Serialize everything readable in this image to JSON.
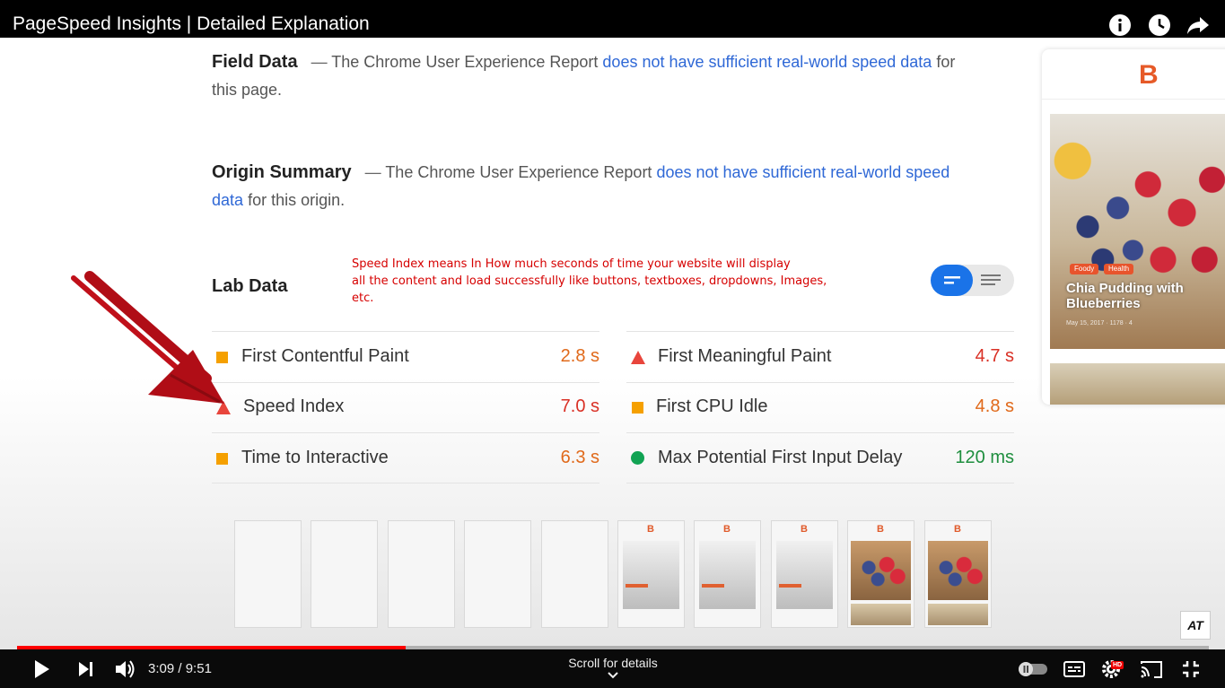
{
  "video": {
    "title": "PageSpeed Insights | Detailed Explanation",
    "time_current": "3:09",
    "time_separator": " / ",
    "time_total": "9:51",
    "progress": 0.326,
    "scroll_hint": "Scroll for details",
    "accent_color": "#ff0000"
  },
  "field_data": {
    "heading": "Field Data",
    "dash": "—",
    "text_before": "The Chrome User Experience Report",
    "link": "does not have sufficient real-world speed data",
    "text_after_line1": "for",
    "text_line2": "this page."
  },
  "origin_summary": {
    "heading": "Origin Summary",
    "dash": "—",
    "text_before": "The Chrome User Experience Report",
    "link_line1": "does not have sufficient real-world speed",
    "link_line2": "data",
    "text_after": "for this origin."
  },
  "lab_data": {
    "heading": "Lab Data",
    "annotation_lines": [
      "Speed Index means In How much seconds of time your website will display",
      "all the content and load successfully like buttons, textboxes, dropdowns, Images,",
      "etc."
    ],
    "metrics": [
      {
        "label": "First Contentful Paint",
        "value": "2.8 s",
        "status": "average"
      },
      {
        "label": "First Meaningful Paint",
        "value": "4.7 s",
        "status": "slow"
      },
      {
        "label": "Speed Index",
        "value": "7.0 s",
        "status": "slow"
      },
      {
        "label": "First CPU Idle",
        "value": "4.8 s",
        "status": "average"
      },
      {
        "label": "Time to Interactive",
        "value": "6.3 s",
        "status": "average"
      },
      {
        "label": "Max Potential First Input Delay",
        "value": "120 ms",
        "status": "fast"
      }
    ],
    "status_colors": {
      "average": "#f5a000",
      "slow": "#e8453c",
      "fast": "#11a353"
    }
  },
  "filmstrip": {
    "frame_logo": "B"
  },
  "side_card": {
    "logo": "B",
    "tags": [
      "Foody",
      "Health"
    ],
    "title_line1": "Chia Pudding with",
    "title_line2": "Blueberries",
    "meta": "May 15, 2017  ·  1178  ·  4"
  },
  "watermark": "AT",
  "icons": [
    "info-icon",
    "watch-later-icon",
    "share-icon",
    "play-icon",
    "next-icon",
    "volume-icon",
    "autoplay-toggle-icon",
    "subtitles-icon",
    "settings-icon",
    "cast-icon",
    "exit-fullscreen-icon",
    "chevron-down-icon"
  ]
}
